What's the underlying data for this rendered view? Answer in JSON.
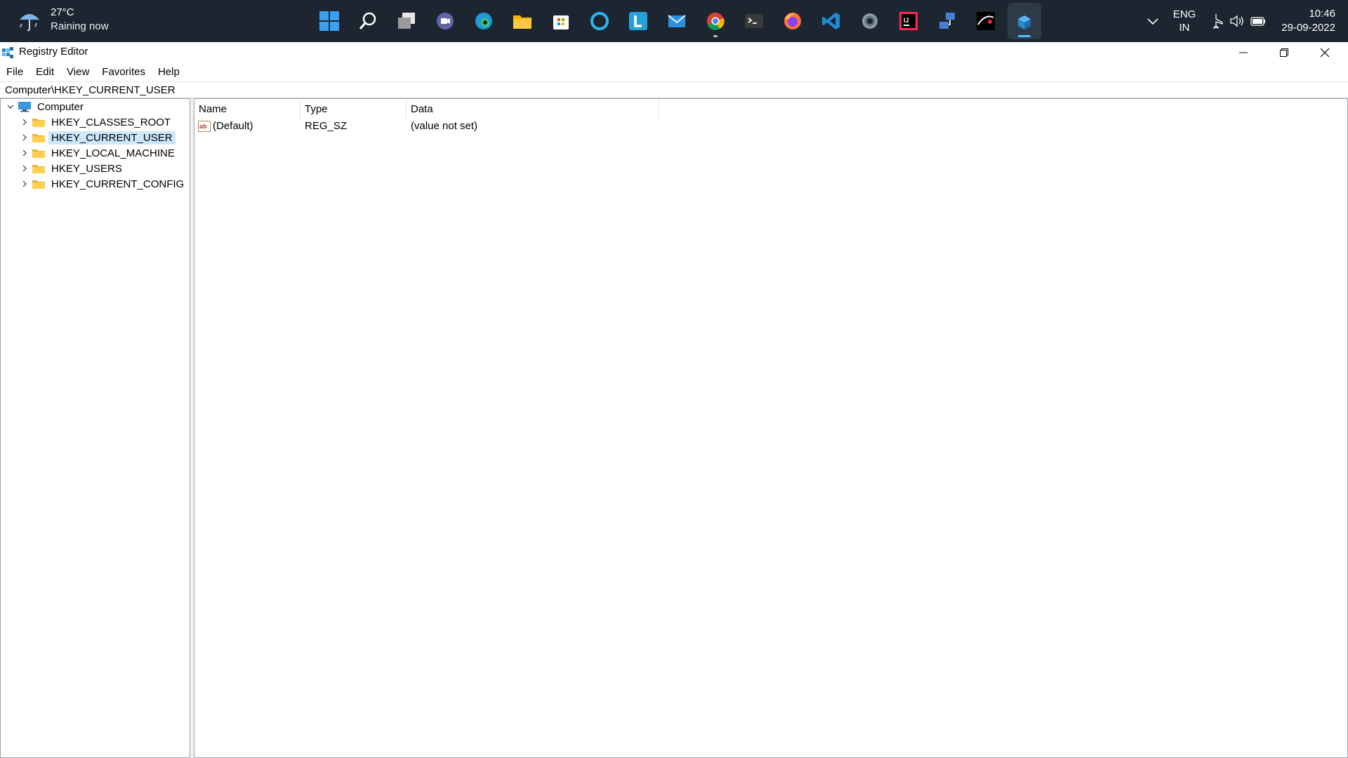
{
  "taskbar": {
    "weather": {
      "temp": "27°C",
      "condition": "Raining now",
      "icon": "umbrella-rain-icon"
    },
    "apps": [
      {
        "name": "start-icon"
      },
      {
        "name": "search-icon"
      },
      {
        "name": "task-view-icon"
      },
      {
        "name": "chat-icon"
      },
      {
        "name": "edge-icon"
      },
      {
        "name": "file-explorer-icon"
      },
      {
        "name": "microsoft-store-icon"
      },
      {
        "name": "cortana-icon"
      },
      {
        "name": "l-app-icon"
      },
      {
        "name": "mail-icon"
      },
      {
        "name": "chrome-icon"
      },
      {
        "name": "terminal-icon"
      },
      {
        "name": "firefox-icon"
      },
      {
        "name": "vscode-icon"
      },
      {
        "name": "settings-icon"
      },
      {
        "name": "intellij-icon"
      },
      {
        "name": "network-app-icon"
      },
      {
        "name": "photo-app-icon"
      },
      {
        "name": "registry-editor-icon"
      }
    ],
    "tray": {
      "lang_top": "ENG",
      "lang_bottom": "IN",
      "time": "10:46",
      "date": "29-09-2022"
    }
  },
  "window": {
    "title": "Registry Editor",
    "menu": [
      "File",
      "Edit",
      "View",
      "Favorites",
      "Help"
    ],
    "address": "Computer\\HKEY_CURRENT_USER"
  },
  "tree": {
    "root": "Computer",
    "children": [
      {
        "label": "HKEY_CLASSES_ROOT"
      },
      {
        "label": "HKEY_CURRENT_USER"
      },
      {
        "label": "HKEY_LOCAL_MACHINE"
      },
      {
        "label": "HKEY_USERS"
      },
      {
        "label": "HKEY_CURRENT_CONFIG"
      }
    ],
    "selected": "HKEY_CURRENT_USER"
  },
  "list": {
    "columns": [
      "Name",
      "Type",
      "Data"
    ],
    "rows": [
      {
        "name": "(Default)",
        "type": "REG_SZ",
        "data": "(value not set)"
      }
    ]
  },
  "colors": {
    "taskbar_bg": "#1c2530",
    "selection": "#cce8ff",
    "accent": "#4cc2ff"
  }
}
